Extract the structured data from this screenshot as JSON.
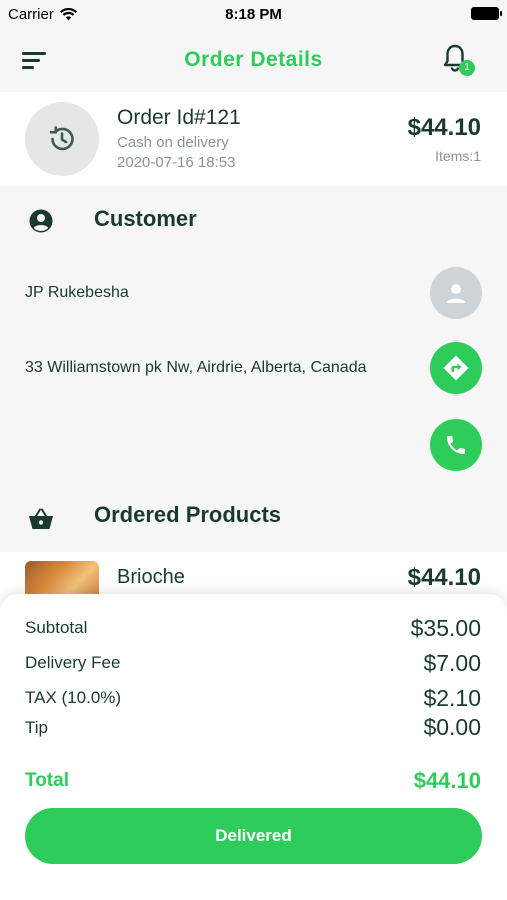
{
  "status_bar": {
    "carrier": "Carrier",
    "time": "8:18 PM"
  },
  "header": {
    "title": "Order Details",
    "notification_count": "1"
  },
  "order": {
    "id_label": "Order Id#121",
    "payment": "Cash on delivery",
    "date": "2020-07-16 18:53",
    "total": "$44.10",
    "items": "Items:1"
  },
  "customer": {
    "section_title": "Customer",
    "name": "JP Rukebesha",
    "address": "33 Williamstown pk Nw, Airdrie, Alberta, Canada"
  },
  "products": {
    "section_title": "Ordered Products",
    "items": [
      {
        "name": "Brioche",
        "price": "$44.10"
      }
    ]
  },
  "summary": {
    "subtotal_label": "Subtotal",
    "subtotal": "$35.00",
    "delivery_label": "Delivery Fee",
    "delivery": "$7.00",
    "tax_label": "TAX (10.0%)",
    "tax": "$2.10",
    "tip_label": "Tip",
    "tip": "$0.00",
    "total_label": "Total",
    "total": "$44.10",
    "button_label": "Delivered"
  },
  "colors": {
    "accent": "#2ecc5a",
    "text_dark": "#1a3a2e",
    "muted": "#8a9690"
  },
  "icons": [
    "wifi-icon",
    "battery-icon",
    "menu-icon",
    "bell-icon",
    "history-icon",
    "user-circle-icon",
    "avatar-icon",
    "directions-icon",
    "phone-icon",
    "basket-icon"
  ]
}
